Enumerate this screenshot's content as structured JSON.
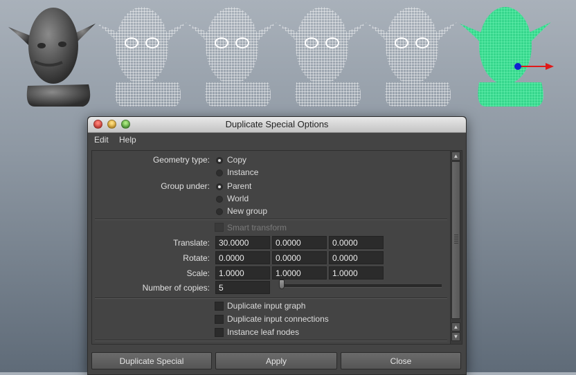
{
  "dialog": {
    "title": "Duplicate Special Options",
    "menu": [
      "Edit",
      "Help"
    ],
    "geometry_type": {
      "label": "Geometry type:",
      "options": [
        "Copy",
        "Instance"
      ],
      "selected": "Copy"
    },
    "group_under": {
      "label": "Group under:",
      "options": [
        "Parent",
        "World",
        "New group"
      ],
      "selected": "Parent"
    },
    "smart_transform": {
      "label": "Smart transform",
      "checked": false,
      "enabled": false
    },
    "translate": {
      "label": "Translate:",
      "values": [
        "30.0000",
        "0.0000",
        "0.0000"
      ]
    },
    "rotate": {
      "label": "Rotate:",
      "values": [
        "0.0000",
        "0.0000",
        "0.0000"
      ]
    },
    "scale": {
      "label": "Scale:",
      "values": [
        "1.0000",
        "1.0000",
        "1.0000"
      ]
    },
    "copies": {
      "label": "Number of copies:",
      "value": "5"
    },
    "checkboxes": [
      {
        "label": "Duplicate input graph",
        "checked": false
      },
      {
        "label": "Duplicate input connections",
        "checked": false
      },
      {
        "label": "Instance leaf nodes",
        "checked": false
      }
    ],
    "buttons": {
      "duplicate": "Duplicate Special",
      "apply": "Apply",
      "close": "Close"
    }
  },
  "viewport": {
    "heads": [
      "shaded",
      "wireframe",
      "wireframe",
      "wireframe",
      "wireframe",
      "selected-wireframe"
    ],
    "colors": {
      "shaded": "#5a5a5a",
      "wire": "#ffffff",
      "selected": "#3df0a0",
      "manip_x": "#e01818",
      "manip_z": "#1020d0"
    }
  }
}
